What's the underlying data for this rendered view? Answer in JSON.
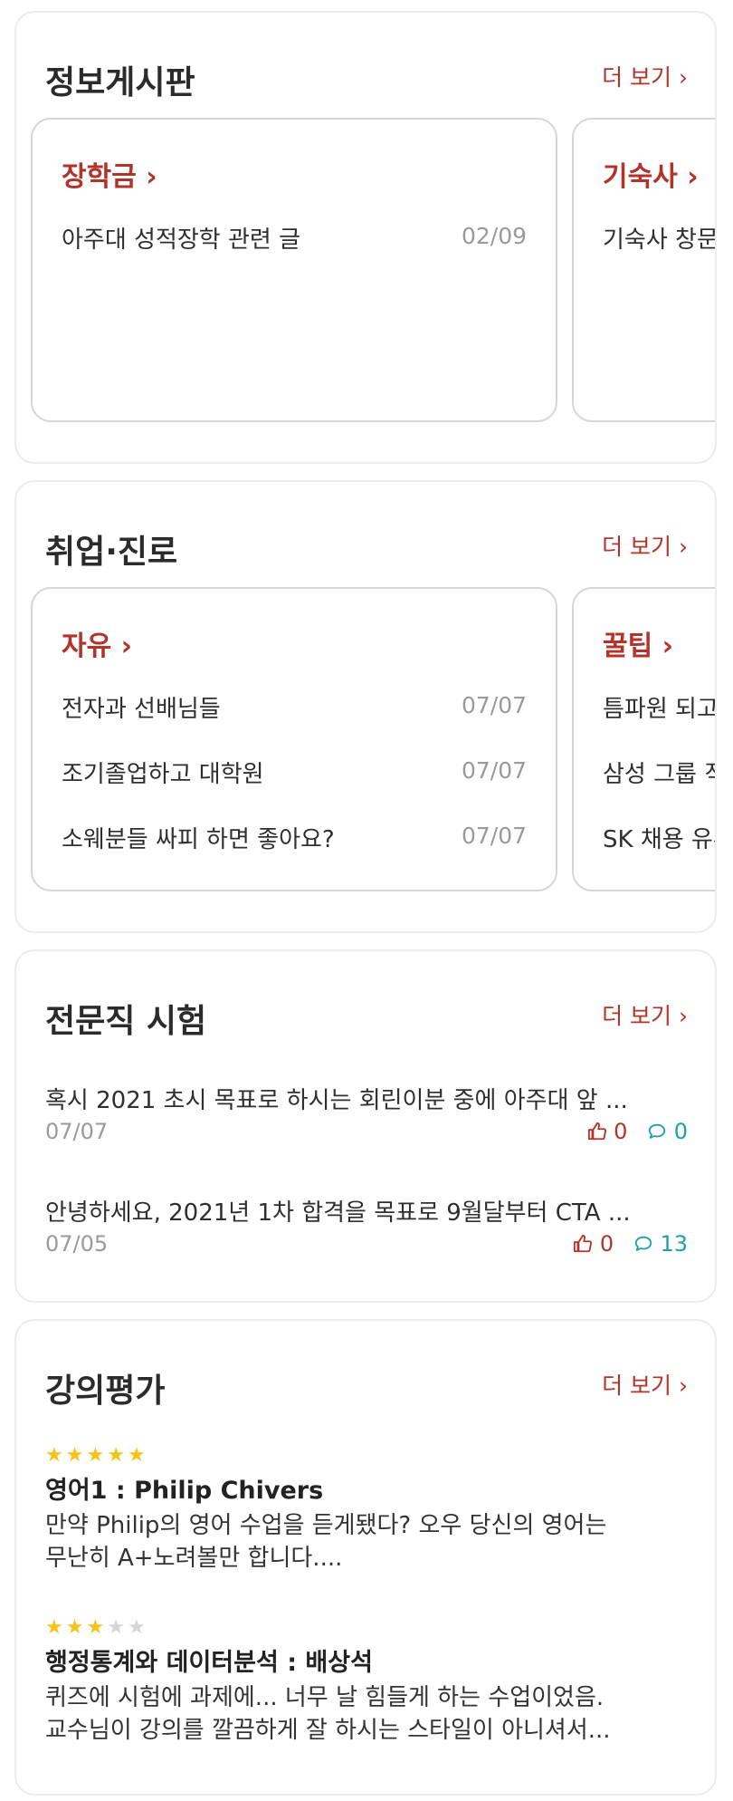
{
  "info_board": {
    "title": "정보게시판",
    "more": "더 보기 ›",
    "cards": [
      {
        "title": "장학금 ›",
        "posts": [
          {
            "text": "아주대 성적장학 관련 글",
            "date": "02/09"
          }
        ]
      },
      {
        "title": "기숙사 ›",
        "posts": [
          {
            "text": "기숙사 창문"
          }
        ]
      }
    ]
  },
  "career": {
    "title": "취업·진로",
    "more": "더 보기 ›",
    "cards": [
      {
        "title": "자유 ›",
        "posts": [
          {
            "text": "전자과 선배님들",
            "date": "07/07"
          },
          {
            "text": "조기졸업하고 대학원",
            "date": "07/07"
          },
          {
            "text": "소웨분들 싸피 하면 좋아요?",
            "date": "07/07"
          }
        ]
      },
      {
        "title": "꿀팁 ›",
        "posts": [
          {
            "text": "틈파원 되고"
          },
          {
            "text": "삼성 그룹 직"
          },
          {
            "text": "SK 채용 유튜"
          }
        ]
      }
    ]
  },
  "professional_exam": {
    "title": "전문직 시험",
    "more": "더 보기 ›",
    "posts": [
      {
        "text": "혹시 2021 초시 목표로 하시는 회린이분 중에 아주대 앞 ...",
        "date": "07/07",
        "likes": "0",
        "comments": "0"
      },
      {
        "text": "안녕하세요, 2021년 1차 합격을 목표로 9월달부터 CTA ...",
        "date": "07/05",
        "likes": "0",
        "comments": "13"
      }
    ]
  },
  "lecture_review": {
    "title": "강의평가",
    "more": "더 보기 ›",
    "reviews": [
      {
        "rating": 5,
        "title": "영어1 : Philip Chivers",
        "line1": "만약 Philip의 영어 수업을 듣게됐다? 오우 당신의 영어는",
        "line2": "무난히 A+노려볼만 합니다...."
      },
      {
        "rating": 3,
        "title": "행정통계와 데이터분석 : 배상석",
        "line1": "퀴즈에 시험에 과제에... 너무 날 힘들게 하는 수업이었음.",
        "line2": "교수님이 강의를 깔끔하게 잘 하시는 스타일이 아니셔서..."
      }
    ]
  },
  "icons": {
    "like": "thumbs-up-icon",
    "comment": "comment-icon",
    "star": "star-icon"
  },
  "colors": {
    "accent": "#b3322a",
    "comment": "#1ea0a5",
    "star": "#f7c21a"
  }
}
